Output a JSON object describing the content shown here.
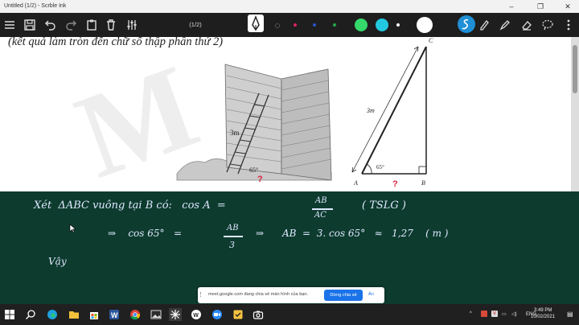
{
  "window": {
    "title": "Untitled (1/2) - Scrble Ink"
  },
  "toolbar": {
    "page_indicator": "(1/2)",
    "ink_colors": [
      "#1a1a1a",
      "#e0245e",
      "#2a54c8",
      "#22a84a",
      "#35d96b",
      "#22c8e0",
      "#ffffff"
    ]
  },
  "document": {
    "heading": "(kết quả làm tròn đến chữ số thập phân thứ 2)",
    "figure": {
      "ladder_length": "3m",
      "angle": "65°",
      "vertices": {
        "a": "A",
        "b": "B",
        "c": "C"
      },
      "side": "3m",
      "question": "?"
    }
  },
  "handwriting": {
    "line1": "Xét  ΔABC vuông tại B có:   cos A  =",
    "frac1_num": "AB",
    "frac1_den": "AC",
    "line1_tail": "( TSLG )",
    "line2_a": "⇒    cos 65°   =",
    "frac2_num": "AB",
    "frac2_den": "3",
    "line2_b": "⇒      AB  =  3. cos 65°   ≈   1,27    ( m )",
    "line3": "Vậy"
  },
  "share_bar": {
    "message": "meet.google.com đang chia sẻ màn hình của bạn.",
    "stop_label": "Dừng chia sẻ",
    "hide_label": "Ẩn"
  },
  "taskbar": {
    "language": "ENG",
    "time": "3:49 PM",
    "date": "10/02/2021"
  }
}
